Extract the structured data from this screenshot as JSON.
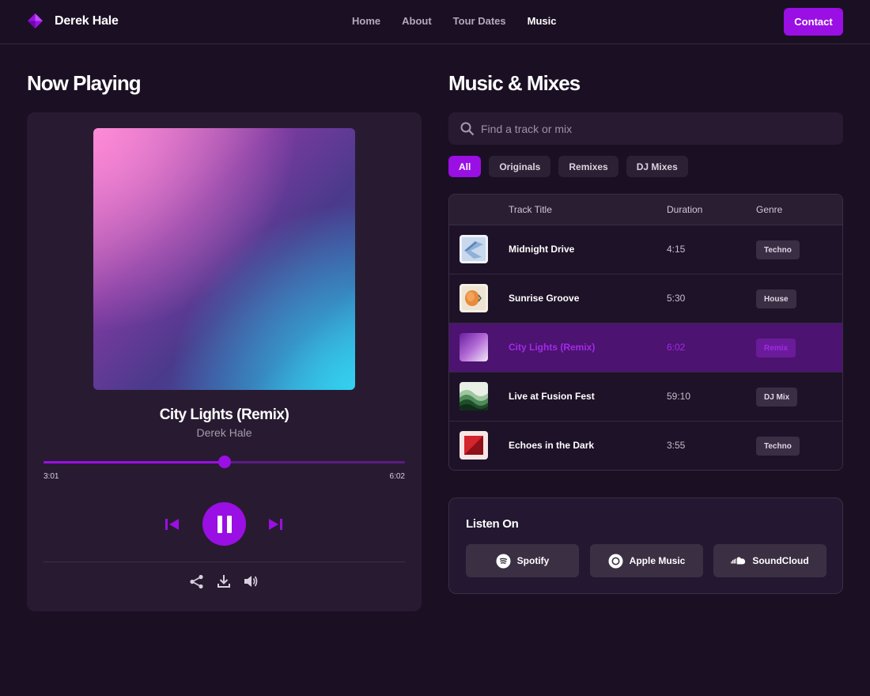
{
  "header": {
    "brand_name": "Derek Hale",
    "nav": [
      "Home",
      "About",
      "Tour Dates",
      "Music"
    ],
    "active_nav": "Music",
    "contact_label": "Contact"
  },
  "now_playing": {
    "heading": "Now Playing",
    "title": "City Lights (Remix)",
    "artist": "Derek Hale",
    "current_time": "3:01",
    "total_time": "6:02",
    "progress": 0.5
  },
  "music": {
    "heading": "Music & Mixes",
    "search_placeholder": "Find a track or mix",
    "filters": [
      "All",
      "Originals",
      "Remixes",
      "DJ Mixes"
    ],
    "active_filter": "All",
    "columns": [
      "Track Title",
      "Duration",
      "Genre"
    ],
    "tracks": [
      {
        "title": "Midnight Drive",
        "duration": "4:15",
        "genre": "Techno",
        "art": "blue-waves"
      },
      {
        "title": "Sunrise Groove",
        "duration": "5:30",
        "genre": "House",
        "art": "orange-sun"
      },
      {
        "title": "City Lights (Remix)",
        "duration": "6:02",
        "genre": "Remix",
        "art": "purple-gradient",
        "active": true
      },
      {
        "title": "Live at Fusion Fest",
        "duration": "59:10",
        "genre": "DJ Mix",
        "art": "green-waves"
      },
      {
        "title": "Echoes in the Dark",
        "duration": "3:55",
        "genre": "Techno",
        "art": "red-square"
      }
    ]
  },
  "listen_on": {
    "heading": "Listen On",
    "platforms": [
      "Spotify",
      "Apple Music",
      "SoundCloud"
    ]
  },
  "colors": {
    "accent": "#9a0fe3",
    "background": "#1b0f24",
    "card": "#281b31"
  }
}
